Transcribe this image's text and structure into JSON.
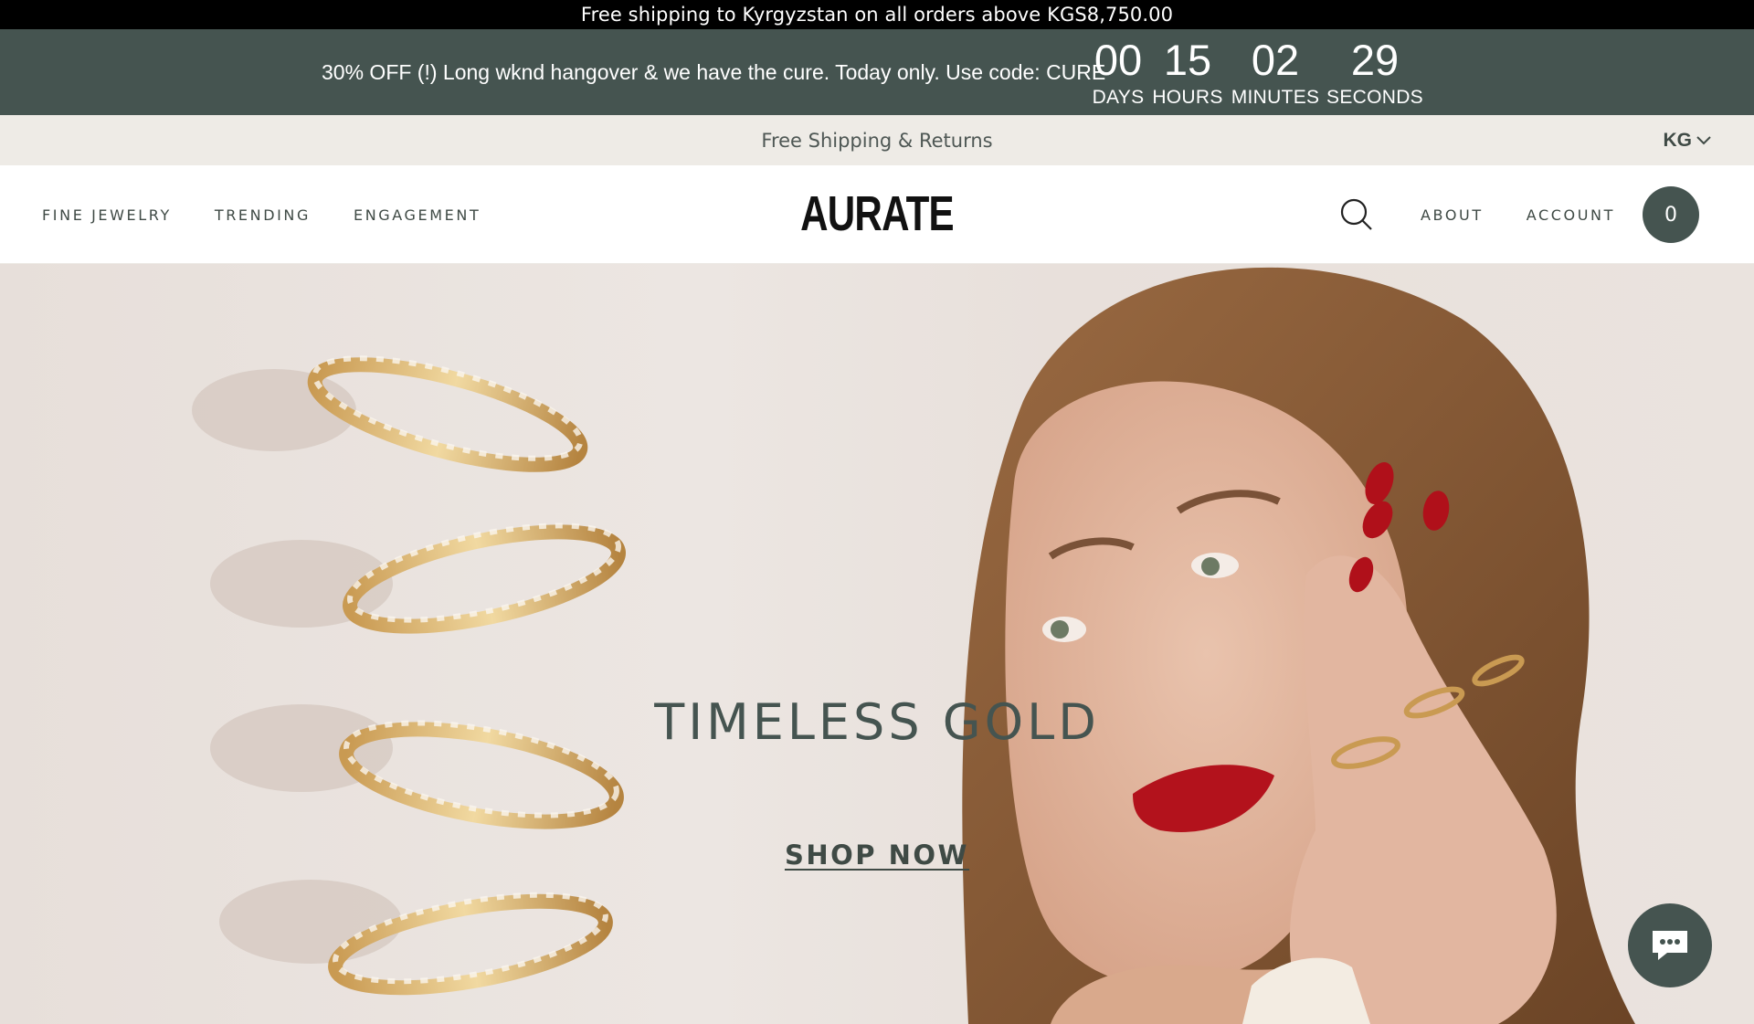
{
  "top_bar": {
    "text": "Free shipping to Kyrgyzstan on all orders above KGS8,750.00"
  },
  "promo": {
    "text": "30% OFF (!) Long wknd hangover & we have the cure. Today only. Use code: CURE",
    "countdown": [
      {
        "value": "00",
        "label": "DAYS"
      },
      {
        "value": "15",
        "label": "HOURS"
      },
      {
        "value": "02",
        "label": "MINUTES"
      },
      {
        "value": "29",
        "label": "SECONDS"
      }
    ]
  },
  "sub_bar": {
    "text": "Free Shipping & Returns",
    "locale": "KG"
  },
  "nav": {
    "left": [
      "FINE JEWELRY",
      "TRENDING",
      "ENGAGEMENT"
    ],
    "logo": "AURATE",
    "right": [
      "ABOUT",
      "ACCOUNT"
    ],
    "cart_count": "0"
  },
  "hero": {
    "title": "TIMELESS GOLD",
    "cta": "SHOP NOW"
  },
  "colors": {
    "brand_green": "#455450",
    "sub_bar_bg": "#eeebe6",
    "top_bar_bg": "#000000"
  },
  "icons": {
    "search": "search-icon",
    "locale_caret": "chevron-down-icon",
    "chat": "chat-bubble-icon"
  }
}
